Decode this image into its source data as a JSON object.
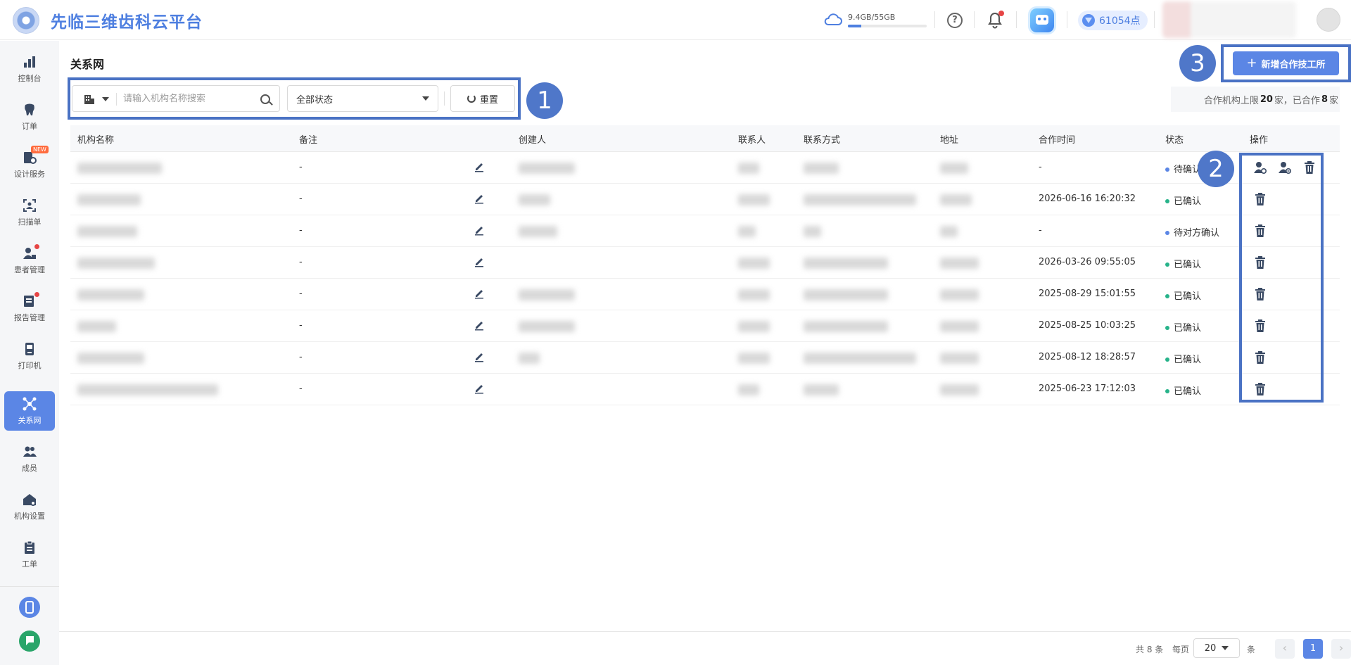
{
  "app": {
    "title": "先临三维齿科云平台"
  },
  "header": {
    "storage": {
      "text": "9.4GB/55GB",
      "used_fraction": 0.17
    },
    "points": "61054点"
  },
  "sidebar": {
    "items": [
      {
        "label": "控制台",
        "icon": "bar-chart-icon"
      },
      {
        "label": "订单",
        "icon": "tooth-icon"
      },
      {
        "label": "设计服务",
        "icon": "design-service-icon",
        "badge": "NEW"
      },
      {
        "label": "扫描单",
        "icon": "scan-icon"
      },
      {
        "label": "患者管理",
        "icon": "patient-icon"
      },
      {
        "label": "报告管理",
        "icon": "report-icon"
      },
      {
        "label": "打印机",
        "icon": "printer-icon"
      },
      {
        "label": "关系网",
        "icon": "network-icon",
        "active": true
      },
      {
        "label": "成员",
        "icon": "members-icon"
      },
      {
        "label": "机构设置",
        "icon": "org-settings-icon"
      },
      {
        "label": "工单",
        "icon": "ticket-icon"
      }
    ]
  },
  "page": {
    "title": "关系网"
  },
  "filters": {
    "search_placeholder": "请输入机构名称搜索",
    "status_value": "全部状态",
    "reset_label": "重置"
  },
  "actions": {
    "add_label": "新增合作技工所",
    "limit_prefix": "合作机构上限",
    "limit_max": "20",
    "limit_mid": "家，已合作",
    "limit_count": "8",
    "limit_suffix": "家"
  },
  "annotations": {
    "one": "1",
    "two": "2",
    "three": "3"
  },
  "table": {
    "headers": {
      "name": "机构名称",
      "remark": "备注",
      "creator": "创建人",
      "contact": "联系人",
      "phone": "联系方式",
      "address": "地址",
      "time": "合作时间",
      "status": "状态",
      "ops": "操作"
    },
    "rows": [
      {
        "remark": "-",
        "time": "-",
        "status": "待确认",
        "status_color": "#5b86e5",
        "ops": [
          "accept-user-icon",
          "reject-user-icon",
          "delete-icon"
        ]
      },
      {
        "remark": "-",
        "time": "2026-06-16 16:20:32",
        "status": "已确认",
        "status_color": "#27b38a",
        "ops": [
          "delete-icon"
        ]
      },
      {
        "remark": "-",
        "time": "-",
        "status": "待对方确认",
        "status_color": "#5b86e5",
        "ops": [
          "delete-icon"
        ]
      },
      {
        "remark": "-",
        "time": "2026-03-26 09:55:05",
        "status": "已确认",
        "status_color": "#27b38a",
        "ops": [
          "delete-icon"
        ]
      },
      {
        "remark": "-",
        "time": "2025-08-29 15:01:55",
        "status": "已确认",
        "status_color": "#27b38a",
        "ops": [
          "delete-icon"
        ]
      },
      {
        "remark": "-",
        "time": "2025-08-25 10:03:25",
        "status": "已确认",
        "status_color": "#27b38a",
        "ops": [
          "delete-icon"
        ]
      },
      {
        "remark": "-",
        "time": "2025-08-12 18:28:57",
        "status": "已确认",
        "status_color": "#27b38a",
        "ops": [
          "delete-icon"
        ]
      },
      {
        "remark": "-",
        "time": "2025-06-23 17:12:03",
        "status": "已确认",
        "status_color": "#27b38a",
        "ops": [
          "delete-icon"
        ]
      }
    ]
  },
  "pagination": {
    "total": "共 8 条",
    "per_page_label": "每页",
    "page_size": "20",
    "unit": "条",
    "current": "1",
    "prev": "‹",
    "next": "›"
  },
  "colors": {
    "brand": "#4e7fe0",
    "active_nav": "#5b86e5",
    "annotation": "#4a72c4"
  }
}
